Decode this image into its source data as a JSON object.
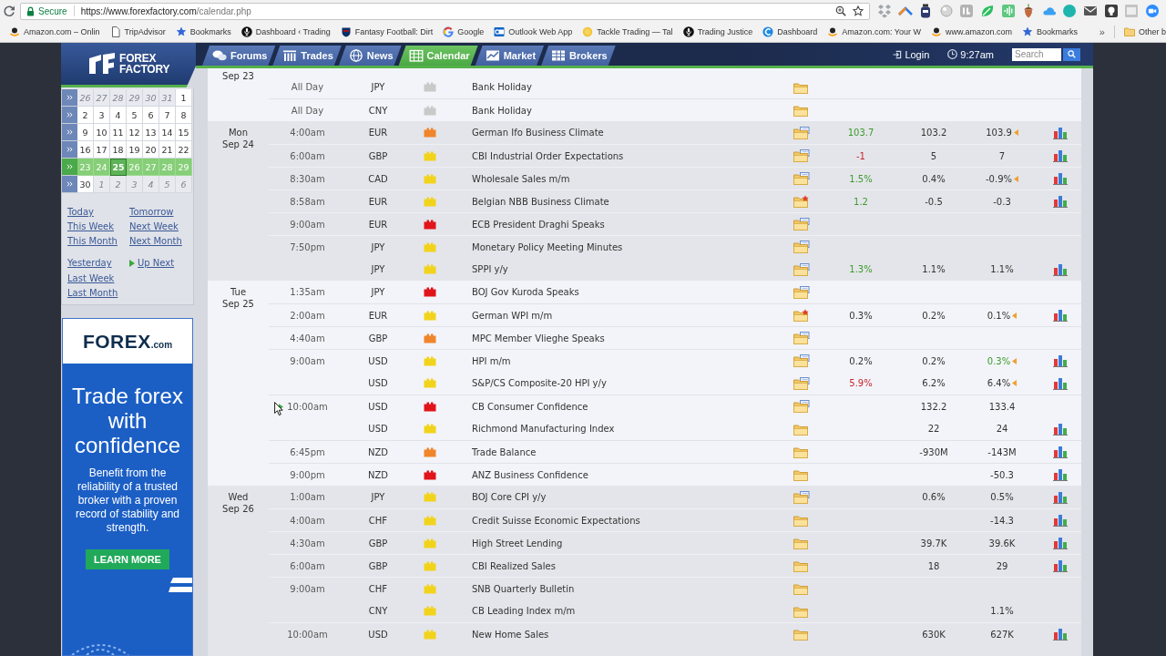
{
  "browser": {
    "address": {
      "secure_label": "Secure",
      "url_host": "https://www.forexfactory.com",
      "url_path": "/calendar.php"
    },
    "bookmarks": [
      {
        "label": "Amazon.com – Onlin",
        "kind": "smile"
      },
      {
        "label": "TripAdvisor",
        "kind": "page"
      },
      {
        "label": "Bookmarks",
        "kind": "star"
      },
      {
        "label": "Dashboard ‹ Trading",
        "kind": "mic"
      },
      {
        "label": "Fantasy Football: Dirt",
        "kind": "shield"
      },
      {
        "label": "Google",
        "kind": "ring"
      },
      {
        "label": "Outlook Web App",
        "kind": "mail"
      },
      {
        "label": "Tackle Trading — Tal",
        "kind": "coin"
      },
      {
        "label": "Trading Justice",
        "kind": "mic"
      },
      {
        "label": "Dashboard",
        "kind": "arc"
      },
      {
        "label": "Amazon.com: Your W",
        "kind": "smile"
      },
      {
        "label": "www.amazon.com",
        "kind": "smile"
      },
      {
        "label": "Bookmarks",
        "kind": "star"
      }
    ],
    "more": "»",
    "other_bookmarks": "Other b"
  },
  "header": {
    "logo": {
      "line1": "FOREX",
      "line2": "FACTORY"
    },
    "tabs": [
      {
        "label": "Forums",
        "kind": "bubbles",
        "selected": false
      },
      {
        "label": "Trades",
        "kind": "columns",
        "selected": false
      },
      {
        "label": "News",
        "kind": "globe",
        "selected": false
      },
      {
        "label": "Calendar",
        "kind": "calendar",
        "selected": true
      },
      {
        "label": "Market",
        "kind": "chart",
        "selected": false
      },
      {
        "label": "Brokers",
        "kind": "grid",
        "selected": false
      }
    ],
    "login": "Login",
    "time": "9:27am",
    "search": {
      "placeholder": "Search"
    }
  },
  "sidebar": {
    "weeks": [
      {
        "selected": false,
        "days": [
          {
            "label": "26",
            "outside": true,
            "today": false
          },
          {
            "label": "27",
            "outside": true,
            "today": false
          },
          {
            "label": "28",
            "outside": true,
            "today": false
          },
          {
            "label": "29",
            "outside": true,
            "today": false
          },
          {
            "label": "30",
            "outside": true,
            "today": false
          },
          {
            "label": "31",
            "outside": true,
            "today": false
          },
          {
            "label": "1",
            "outside": false,
            "today": false
          }
        ]
      },
      {
        "selected": false,
        "days": [
          {
            "label": "2",
            "outside": false,
            "today": false
          },
          {
            "label": "3",
            "outside": false,
            "today": false
          },
          {
            "label": "4",
            "outside": false,
            "today": false
          },
          {
            "label": "5",
            "outside": false,
            "today": false
          },
          {
            "label": "6",
            "outside": false,
            "today": false
          },
          {
            "label": "7",
            "outside": false,
            "today": false
          },
          {
            "label": "8",
            "outside": false,
            "today": false
          }
        ]
      },
      {
        "selected": false,
        "days": [
          {
            "label": "9",
            "outside": false,
            "today": false
          },
          {
            "label": "10",
            "outside": false,
            "today": false
          },
          {
            "label": "11",
            "outside": false,
            "today": false
          },
          {
            "label": "12",
            "outside": false,
            "today": false
          },
          {
            "label": "13",
            "outside": false,
            "today": false
          },
          {
            "label": "14",
            "outside": false,
            "today": false
          },
          {
            "label": "15",
            "outside": false,
            "today": false
          }
        ]
      },
      {
        "selected": false,
        "days": [
          {
            "label": "16",
            "outside": false,
            "today": false
          },
          {
            "label": "17",
            "outside": false,
            "today": false
          },
          {
            "label": "18",
            "outside": false,
            "today": false
          },
          {
            "label": "19",
            "outside": false,
            "today": false
          },
          {
            "label": "20",
            "outside": false,
            "today": false
          },
          {
            "label": "21",
            "outside": false,
            "today": false
          },
          {
            "label": "22",
            "outside": false,
            "today": false
          }
        ]
      },
      {
        "selected": true,
        "days": [
          {
            "label": "23",
            "outside": false,
            "today": false
          },
          {
            "label": "24",
            "outside": false,
            "today": false
          },
          {
            "label": "25",
            "outside": false,
            "today": true
          },
          {
            "label": "26",
            "outside": false,
            "today": false
          },
          {
            "label": "27",
            "outside": false,
            "today": false
          },
          {
            "label": "28",
            "outside": false,
            "today": false
          },
          {
            "label": "29",
            "outside": false,
            "today": false
          }
        ]
      },
      {
        "selected": false,
        "days": [
          {
            "label": "30",
            "outside": false,
            "today": false
          },
          {
            "label": "1",
            "outside": true,
            "today": false
          },
          {
            "label": "2",
            "outside": true,
            "today": false
          },
          {
            "label": "3",
            "outside": true,
            "today": false
          },
          {
            "label": "4",
            "outside": true,
            "today": false
          },
          {
            "label": "5",
            "outside": true,
            "today": false
          },
          {
            "label": "6",
            "outside": true,
            "today": false
          }
        ]
      }
    ],
    "link_groups": [
      [
        [
          {
            "label": "Today",
            "kind": "plain"
          },
          {
            "label": "Tomorrow",
            "kind": "plain"
          }
        ],
        [
          {
            "label": "This Week",
            "kind": "plain"
          },
          {
            "label": "Next Week",
            "kind": "plain"
          }
        ],
        [
          {
            "label": "This Month",
            "kind": "plain"
          },
          {
            "label": "Next Month",
            "kind": "plain"
          }
        ]
      ],
      [
        [
          {
            "label": "Yesterday",
            "kind": "plain"
          },
          {
            "label": "Up Next",
            "kind": "up_next"
          }
        ],
        [
          {
            "label": "Last Week",
            "kind": "plain"
          }
        ],
        [
          {
            "label": "Last Month",
            "kind": "plain"
          }
        ]
      ]
    ]
  },
  "ad": {
    "brand": "FOREX",
    "brand_suffix": ".com",
    "headline": "Trade forex with confidence",
    "body": "Benefit from the reliability of a trusted broker with a proven record of stability and strength.",
    "button": "LEARN MORE"
  },
  "calendar_table": {
    "days": [
      {
        "date": "Sep 23",
        "events": [
          {
            "time": "All Day",
            "currency": "JPY",
            "color": "#c9c9c9",
            "title": "Bank Holiday",
            "kind": "folder",
            "revised": false,
            "graph": false,
            "up_next": false
          },
          {
            "time": "All Day",
            "currency": "CNY",
            "color": "#c9c9c9",
            "title": "Bank Holiday",
            "kind": "folder",
            "revised": false,
            "graph": false,
            "up_next": false
          }
        ]
      },
      {
        "weekday": "Mon",
        "date": "Sep 24",
        "events": [
          {
            "time": "4:00am",
            "currency": "EUR",
            "color": "#f0852c",
            "title": "German Ifo Business Climate",
            "kind": "document",
            "actual": {
              "value": "103.7",
              "color": "#3c9a2d"
            },
            "forecast": "103.2",
            "previous": {
              "value": "103.9",
              "color": "#333333"
            },
            "revised": true,
            "graph": true,
            "up_next": false
          },
          {
            "time": "6:00am",
            "currency": "GBP",
            "color": "#f2d31b",
            "title": "CBI Industrial Order Expectations",
            "kind": "document",
            "actual": {
              "value": "-1",
              "color": "#c5262c"
            },
            "forecast": "5",
            "previous": {
              "value": "7",
              "color": "#333333"
            },
            "revised": false,
            "graph": true,
            "up_next": false
          },
          {
            "time": "8:30am",
            "currency": "CAD",
            "color": "#f2d31b",
            "title": "Wholesale Sales m/m",
            "kind": "document",
            "actual": {
              "value": "1.5%",
              "color": "#3c9a2d"
            },
            "forecast": "0.4%",
            "previous": {
              "value": "-0.9%",
              "color": "#333333"
            },
            "revised": true,
            "graph": true,
            "up_next": false
          },
          {
            "time": "8:58am",
            "currency": "EUR",
            "color": "#f2d31b",
            "title": "Belgian NBB Business Climate",
            "kind": "star",
            "actual": {
              "value": "1.2",
              "color": "#3c9a2d"
            },
            "forecast": "-0.5",
            "previous": {
              "value": "-0.3",
              "color": "#333333"
            },
            "revised": false,
            "graph": true,
            "up_next": false
          },
          {
            "time": "9:00am",
            "currency": "EUR",
            "color": "#e0141a",
            "title": "ECB President Draghi Speaks",
            "kind": "document",
            "revised": false,
            "graph": false,
            "up_next": false
          },
          {
            "time": "7:50pm",
            "currency": "JPY",
            "color": "#f2d31b",
            "title": "Monetary Policy Meeting Minutes",
            "kind": "document",
            "revised": false,
            "graph": false,
            "up_next": false
          },
          {
            "currency": "JPY",
            "color": "#f2d31b",
            "title": "SPPI y/y",
            "kind": "document",
            "actual": {
              "value": "1.3%",
              "color": "#3c9a2d"
            },
            "forecast": "1.1%",
            "previous": {
              "value": "1.1%",
              "color": "#333333"
            },
            "revised": false,
            "graph": true,
            "up_next": false
          }
        ]
      },
      {
        "weekday": "Tue",
        "date": "Sep 25",
        "events": [
          {
            "time": "1:35am",
            "currency": "JPY",
            "color": "#e0141a",
            "title": "BOJ Gov Kuroda Speaks",
            "kind": "document",
            "revised": false,
            "graph": false,
            "up_next": false
          },
          {
            "time": "2:00am",
            "currency": "EUR",
            "color": "#f2d31b",
            "title": "German WPI m/m",
            "kind": "star",
            "actual": {
              "value": "0.3%",
              "color": "#333333"
            },
            "forecast": "0.2%",
            "previous": {
              "value": "0.1%",
              "color": "#333333"
            },
            "revised": true,
            "graph": true,
            "up_next": false
          },
          {
            "time": "4:40am",
            "currency": "GBP",
            "color": "#f0852c",
            "title": "MPC Member Vlieghe Speaks",
            "kind": "document",
            "revised": false,
            "graph": false,
            "up_next": false
          },
          {
            "time": "9:00am",
            "currency": "USD",
            "color": "#f2d31b",
            "title": "HPI m/m",
            "kind": "document",
            "actual": {
              "value": "0.2%",
              "color": "#333333"
            },
            "forecast": "0.2%",
            "previous": {
              "value": "0.3%",
              "color": "#3c9a2d"
            },
            "revised": true,
            "graph": true,
            "up_next": false
          },
          {
            "currency": "USD",
            "color": "#f2d31b",
            "title": "S&P/CS Composite-20 HPI y/y",
            "kind": "document",
            "actual": {
              "value": "5.9%",
              "color": "#c5262c"
            },
            "forecast": "6.2%",
            "previous": {
              "value": "6.4%",
              "color": "#333333"
            },
            "revised": true,
            "graph": true,
            "up_next": false
          },
          {
            "time": "10:00am",
            "currency": "USD",
            "color": "#e0141a",
            "title": "CB Consumer Confidence",
            "kind": "document",
            "forecast": "132.2",
            "previous": {
              "value": "133.4",
              "color": "#333333"
            },
            "revised": false,
            "graph": false,
            "up_next": true
          },
          {
            "currency": "USD",
            "color": "#f2d31b",
            "title": "Richmond Manufacturing Index",
            "kind": "folder",
            "forecast": "22",
            "previous": {
              "value": "24",
              "color": "#333333"
            },
            "revised": false,
            "graph": true,
            "up_next": false
          },
          {
            "time": "6:45pm",
            "currency": "NZD",
            "color": "#f0852c",
            "title": "Trade Balance",
            "kind": "folder",
            "forecast": "-930M",
            "previous": {
              "value": "-143M",
              "color": "#333333"
            },
            "revised": false,
            "graph": true,
            "up_next": false
          },
          {
            "time": "9:00pm",
            "currency": "NZD",
            "color": "#e0141a",
            "title": "ANZ Business Confidence",
            "kind": "folder",
            "previous": {
              "value": "-50.3",
              "color": "#333333"
            },
            "revised": false,
            "graph": true,
            "up_next": false
          }
        ]
      },
      {
        "weekday": "Wed",
        "date": "Sep 26",
        "events": [
          {
            "time": "1:00am",
            "currency": "JPY",
            "color": "#f2d31b",
            "title": "BOJ Core CPI y/y",
            "kind": "document",
            "forecast": "0.6%",
            "previous": {
              "value": "0.5%",
              "color": "#333333"
            },
            "revised": false,
            "graph": true,
            "up_next": false
          },
          {
            "time": "4:00am",
            "currency": "CHF",
            "color": "#f2d31b",
            "title": "Credit Suisse Economic Expectations",
            "kind": "folder",
            "previous": {
              "value": "-14.3",
              "color": "#333333"
            },
            "revised": false,
            "graph": true,
            "up_next": false
          },
          {
            "time": "4:30am",
            "currency": "GBP",
            "color": "#f2d31b",
            "title": "High Street Lending",
            "kind": "folder",
            "forecast": "39.7K",
            "previous": {
              "value": "39.6K",
              "color": "#333333"
            },
            "revised": false,
            "graph": true,
            "up_next": false
          },
          {
            "time": "6:00am",
            "currency": "GBP",
            "color": "#f2d31b",
            "title": "CBI Realized Sales",
            "kind": "folder",
            "forecast": "18",
            "previous": {
              "value": "29",
              "color": "#333333"
            },
            "revised": false,
            "graph": true,
            "up_next": false
          },
          {
            "time": "9:00am",
            "currency": "CHF",
            "color": "#f2d31b",
            "title": "SNB Quarterly Bulletin",
            "kind": "folder",
            "revised": false,
            "graph": false,
            "up_next": false
          },
          {
            "currency": "CNY",
            "color": "#f2d31b",
            "title": "CB Leading Index m/m",
            "kind": "folder",
            "previous": {
              "value": "1.1%",
              "color": "#333333"
            },
            "revised": false,
            "graph": false,
            "up_next": false
          },
          {
            "time": "10:00am",
            "currency": "USD",
            "color": "#f2d31b",
            "title": "New Home Sales",
            "kind": "folder",
            "forecast": "630K",
            "previous": {
              "value": "627K",
              "color": "#333333"
            },
            "revised": false,
            "graph": true,
            "up_next": false
          }
        ]
      }
    ]
  }
}
